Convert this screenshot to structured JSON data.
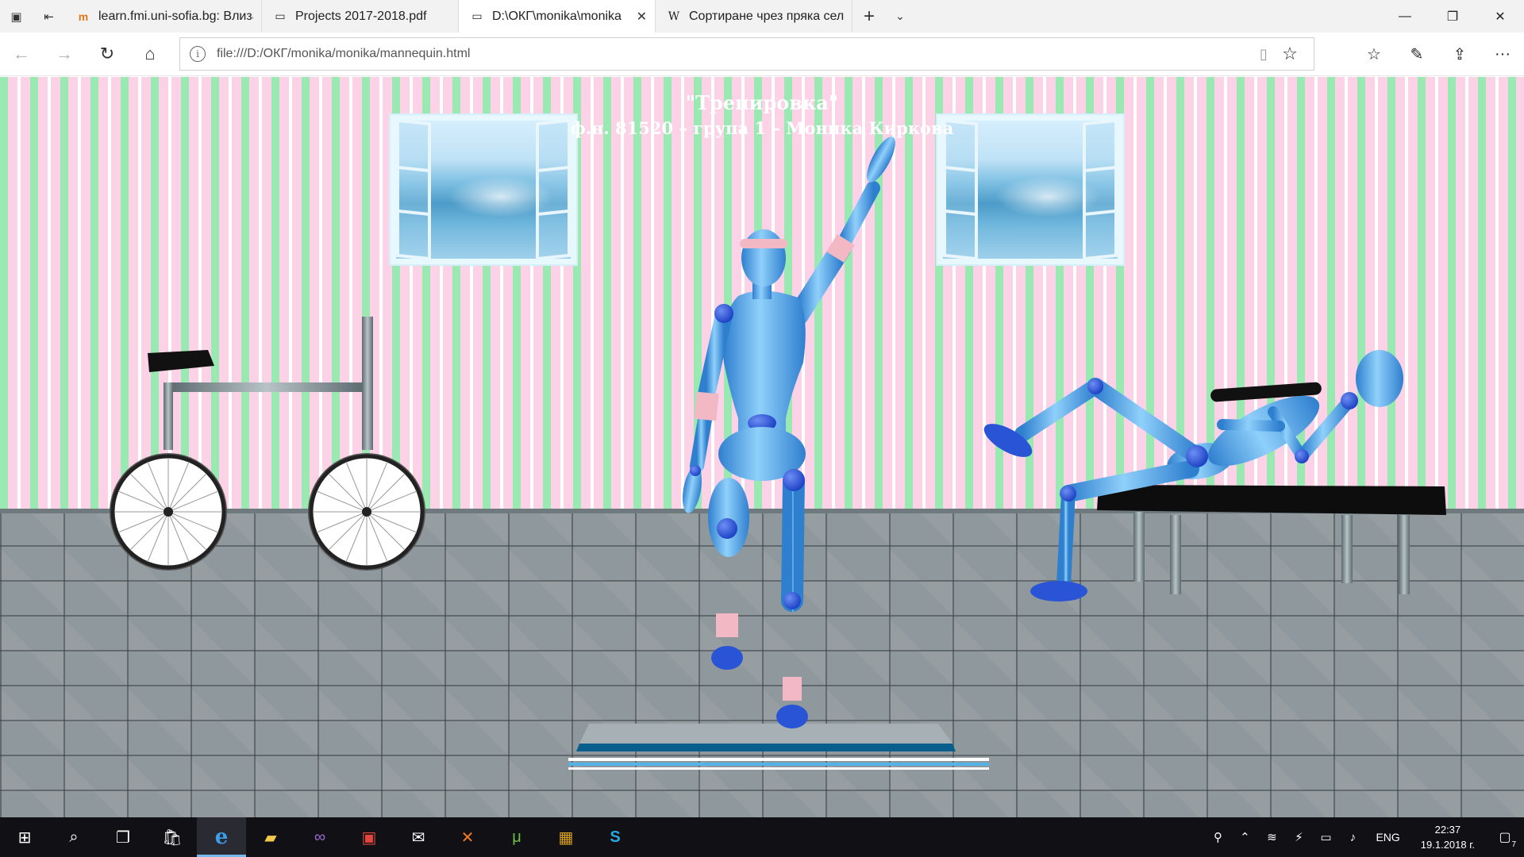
{
  "tabs": [
    {
      "title": "learn.fmi.uni-sofia.bg: Влиза",
      "icon": "moodle-icon",
      "active": false
    },
    {
      "title": "Projects 2017-2018.pdf",
      "icon": "pdf-page-icon",
      "active": false
    },
    {
      "title": "D:\\ОКГ\\monika\\monika",
      "icon": "page-icon",
      "active": true
    },
    {
      "title": "Сортиране чрез пряка сел",
      "icon": "wikipedia-icon",
      "active": false
    }
  ],
  "address": {
    "url": "file:///D:/ОКГ/monika/monika/mannequin.html"
  },
  "scene": {
    "title": "\"Тренировка\"",
    "subtitle": "ф.н. 81520 – група 1 – Моника Киркова"
  },
  "clock": {
    "time": "22:37",
    "date": "19.1.2018 г."
  },
  "tray": {
    "language": "ENG",
    "notifications": "7"
  },
  "colors": {
    "wall_green": "#9ae9b2",
    "wall_pink": "#fbd2e6",
    "mannequin_blue": "#5aa9e6",
    "joint_blue": "#2a54d6",
    "floor_grey": "#8f989c"
  }
}
